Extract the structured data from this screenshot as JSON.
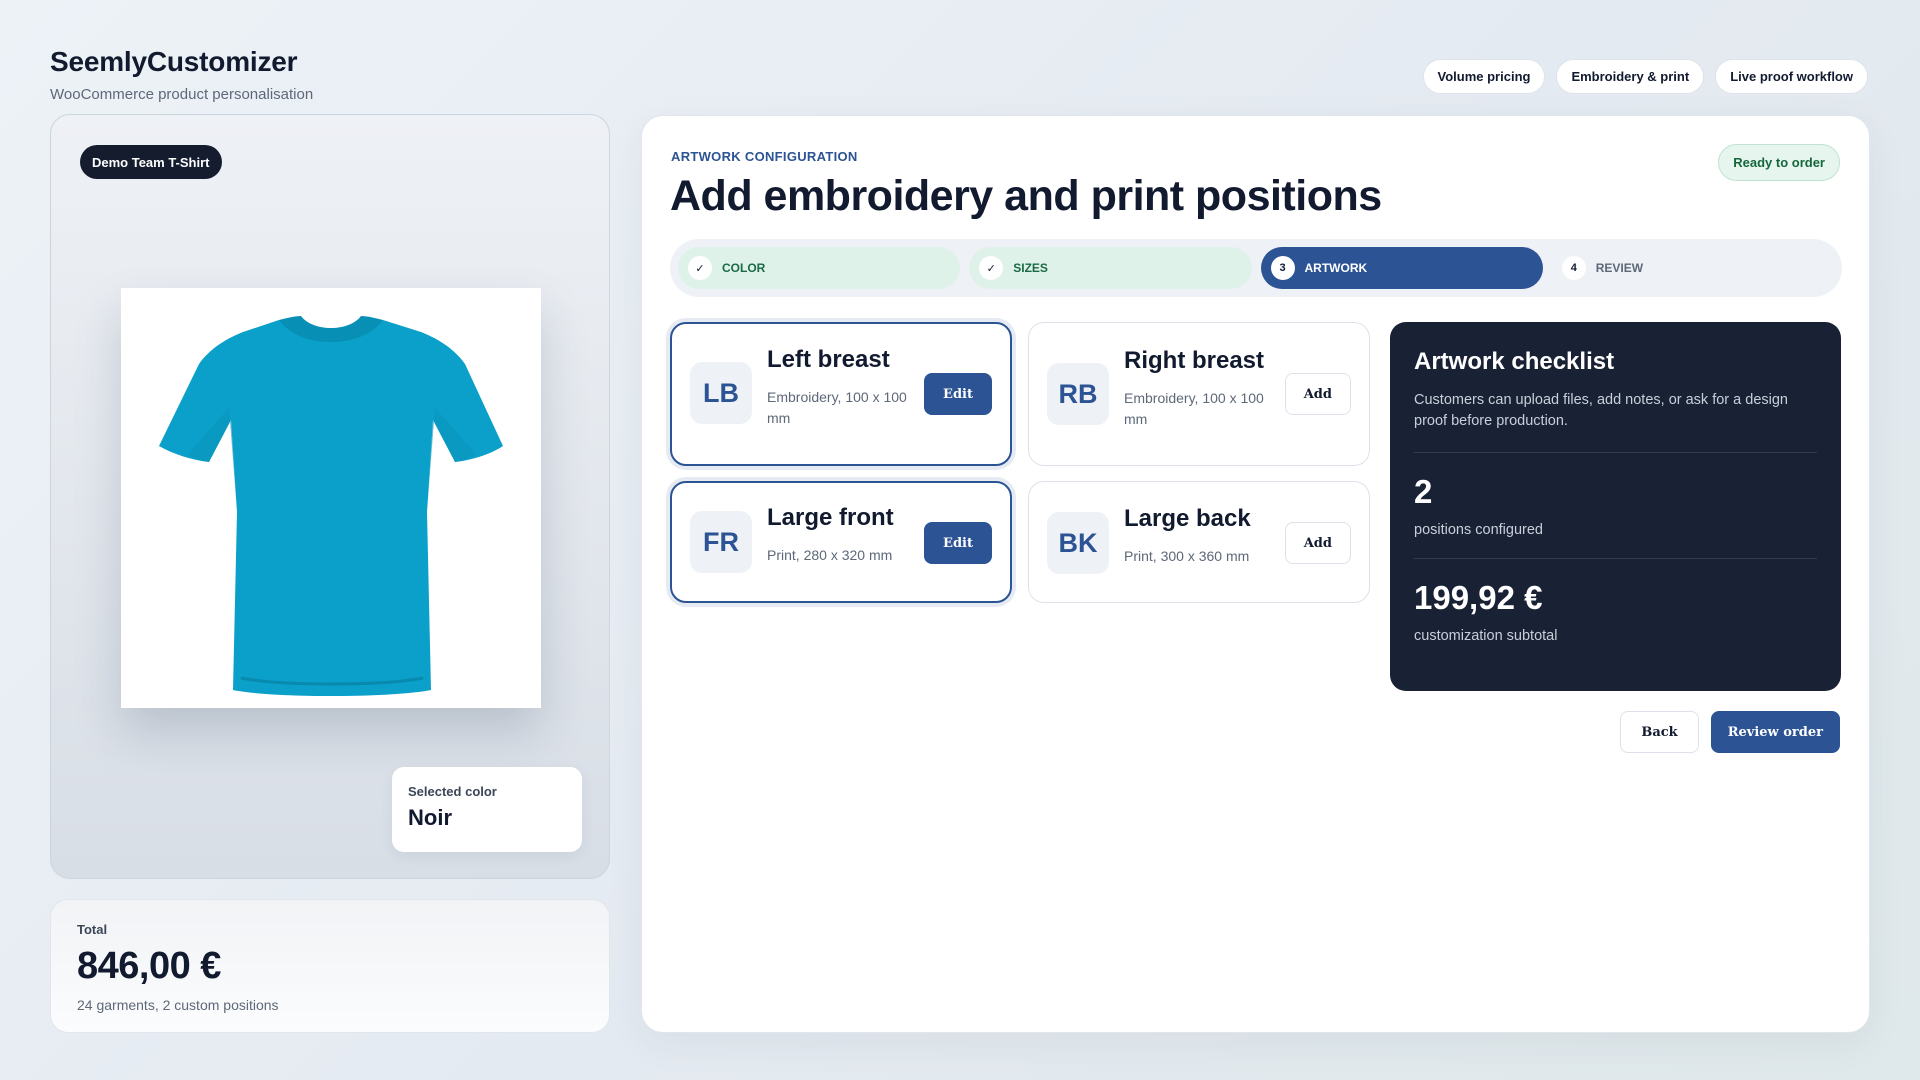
{
  "brand": {
    "title": "SeemlyCustomizer",
    "subtitle": "WooCommerce product personalisation"
  },
  "top_pills": [
    "Volume pricing",
    "Embroidery & print",
    "Live proof workflow"
  ],
  "product": {
    "badge": "Demo Team T-Shirt",
    "image_icon": "tshirt-image",
    "shirt_color": "#0aa0c9",
    "selected_color_label": "Selected color",
    "selected_color_value": "Noir"
  },
  "total": {
    "label": "Total",
    "value": "846,00 €",
    "sub": "24 garments, 2 custom positions"
  },
  "main": {
    "eyebrow": "ARTWORK CONFIGURATION",
    "title": "Add embroidery and print positions",
    "status": "Ready to order",
    "steps": [
      {
        "marker": "✓",
        "label": "COLOR",
        "state": "done"
      },
      {
        "marker": "✓",
        "label": "SIZES",
        "state": "done"
      },
      {
        "marker": "3",
        "label": "ARTWORK",
        "state": "active"
      },
      {
        "marker": "4",
        "label": "REVIEW",
        "state": "todo"
      }
    ],
    "positions": [
      {
        "abbr": "LB",
        "name": "Left breast",
        "desc": "Embroidery, 100 x 100 mm",
        "action": "Edit"
      },
      {
        "abbr": "RB",
        "name": "Right breast",
        "desc": "Embroidery, 100 x 100 mm",
        "action": "Add"
      },
      {
        "abbr": "FR",
        "name": "Large front",
        "desc": "Print, 280 x 320 mm",
        "action": "Edit"
      },
      {
        "abbr": "BK",
        "name": "Large back",
        "desc": "Print, 300 x 360 mm",
        "action": "Add"
      }
    ],
    "checklist": {
      "title": "Artwork checklist",
      "desc": "Customers can upload files, add notes, or ask for a design proof before production.",
      "count": "2",
      "count_label": "positions configured",
      "subtotal": "199,92 €",
      "subtotal_label": "customization subtotal"
    },
    "back_label": "Back",
    "review_label": "Review order"
  },
  "colors": {
    "accent": "#2c5394",
    "dark": "#192134",
    "success_bg": "#e6f6ee"
  }
}
